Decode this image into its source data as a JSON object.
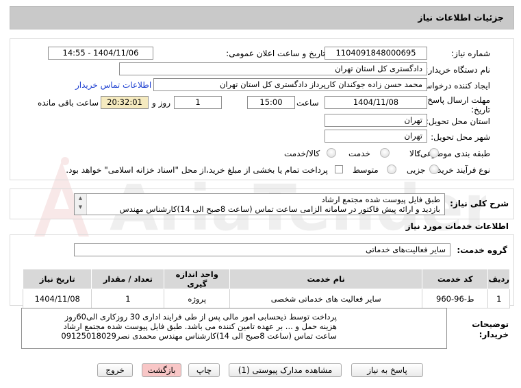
{
  "header": {
    "title": "جزئیات اطلاعات نیاز"
  },
  "form": {
    "need_number_label": "شماره نیاز:",
    "need_number": "1104091848000695",
    "announce_label": "تاریخ و ساعت اعلان عمومی:",
    "announce_value": "1404/11/06 - 14:55",
    "buyer_label": "نام دستگاه خریدار:",
    "buyer_value": "دادگستری کل استان تهران",
    "creator_label": "ایجاد کننده درخواست:",
    "creator_value": "محمد حسن زاده جوکندان کارپرداز دادگستری کل استان تهران",
    "contact_link": "اطلاعات تماس خریدار",
    "deadline_label_1": "مهلت ارسال پاسخ: تا",
    "deadline_label_2": "تاریخ:",
    "deadline_date": "1404/11/08",
    "time_label": "ساعت",
    "deadline_time": "15:00",
    "days_value": "1",
    "days_label": "روز و",
    "remaining_time": "20:32:01",
    "remaining_label": "ساعت باقی مانده",
    "province_label": "استان محل تحویل:",
    "province_value": "تهران",
    "city_label": "شهر محل تحویل:",
    "city_value": "تهران",
    "category_label": "طبقه بندی موضوعی:",
    "category_options": [
      "کالا",
      "خدمت",
      "کالا/خدمت"
    ],
    "process_label": "نوع فرآیند خرید :",
    "process_options": [
      "جزیی",
      "متوسط"
    ],
    "process_note": "پرداخت تمام یا بخشی از مبلغ خرید،از محل \"اسناد خزانه اسلامی\" خواهد بود."
  },
  "summary": {
    "label": "شرح کلی نیاز:",
    "line1": "طبق فایل پیوست شده مجتمع ارشاد",
    "line2": "بازدید و ارائه پیش  فاکتور در سامانه الزامی ساعت تماس (ساعت 8صبح الی 14)کارشناس مهندس"
  },
  "services": {
    "section_title": "اطلاعات خدمات مورد نیاز",
    "group_label": "گروه خدمت:",
    "group_value": "سایر فعالیت‌های خدماتی",
    "columns": [
      "ردیف",
      "کد خدمت",
      "نام خدمت",
      "واحد اندازه گیری",
      "تعداد / مقدار",
      "تاریخ نیاز"
    ],
    "rows": [
      {
        "row": "1",
        "code": "ط-96-960",
        "name": "سایر فعالیت های خدماتی شخصی",
        "unit": "پروژه",
        "qty": "1",
        "date": "1404/11/08"
      }
    ]
  },
  "buyer_notes": {
    "label_1": "توضیحات",
    "label_2": "خریدار:",
    "line1": "پرداخت توسط ذیحسابی امور مالی پس از طی فرایند اداری 30 روزکاری الی60روز",
    "line2": "هزینه حمل و ... بر عهده تامین کننده می باشد. طبق فایل پیوست شده مجتمع ارشاد",
    "line3": "ساعت تماس (ساعت 8صبح الی 14)کارشناس مهندس محمدی نصر09125018029"
  },
  "buttons": {
    "reply": "پاسخ به نیاز",
    "docs": "مشاهده مدارک پیوستی (1)",
    "print": "چاپ",
    "back": "بازگشت",
    "exit": "خروج"
  },
  "watermark": {
    "text": "AriaTender.net"
  },
  "colors": {
    "header_bg": "#c9c9c9",
    "remaining_bg": "#f5eabf",
    "link": "#1d3fd0",
    "back_bg": "#f8c6c6"
  }
}
